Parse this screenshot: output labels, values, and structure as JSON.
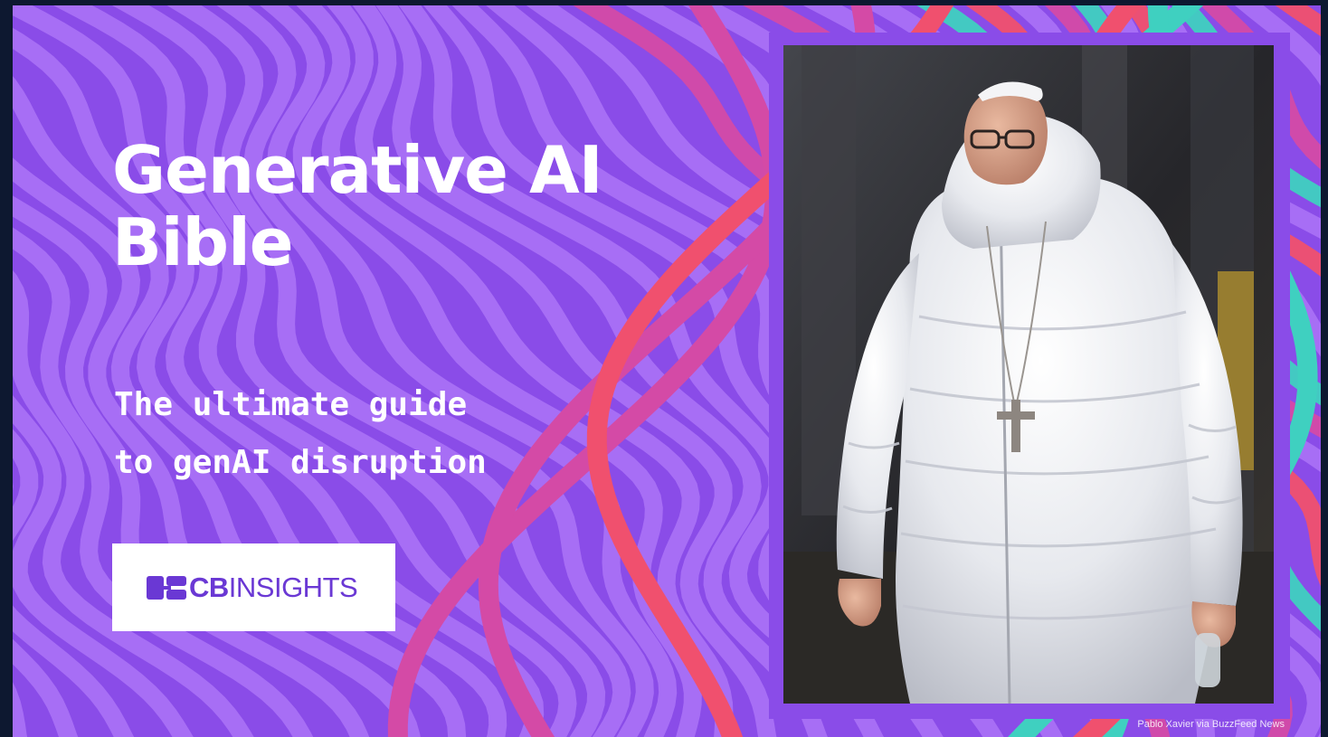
{
  "banner": {
    "title_line_1": "Generative AI",
    "title_line_2": "Bible",
    "subtitle_line_1": "The ultimate guide",
    "subtitle_line_2": "to genAI disruption",
    "logo": {
      "text_bold": "CB",
      "text_light": "INSIGHTS",
      "color": "#6a38d4"
    },
    "photo": {
      "subject": "figure-in-white-puffer-coat",
      "credit": "Pablo Xavier via BuzzFeed News"
    },
    "colors": {
      "background": "#8a4ce8",
      "wave_purple": "#a970f5",
      "wave_pink": "#d44aa6",
      "wave_red": "#f0506e",
      "wave_teal": "#3fd0c0",
      "frame_purple": "#7a3fe6",
      "text": "#ffffff",
      "outer_frame": "#0d1830"
    }
  }
}
